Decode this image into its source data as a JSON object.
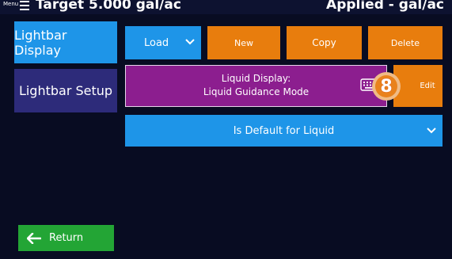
{
  "header": {
    "menu_label": "Menu",
    "target": "Target 5.000 gal/ac",
    "applied": "Applied - gal/ac"
  },
  "sidebar": {
    "items": [
      {
        "label": "Lightbar Display",
        "active": true
      },
      {
        "label": "Lightbar Setup",
        "active": false
      }
    ],
    "return_label": "Return"
  },
  "toolbar": {
    "load_label": "Load",
    "new_label": "New",
    "copy_label": "Copy",
    "delete_label": "Delete"
  },
  "display_panel": {
    "line1": "Liquid Display:",
    "line2": "Liquid Guidance Mode",
    "edit_label": "Edit",
    "keyboard_icon": "keyboard-icon"
  },
  "step_badge": "8",
  "default_select": {
    "value": "Is Default for Liquid"
  },
  "colors": {
    "background": "#080c22",
    "accent_blue": "#1e95e8",
    "orange": "#e87d0d",
    "purple": "#8c1e8f",
    "sidebar_inactive": "#2d2b7a",
    "green": "#23a535"
  }
}
